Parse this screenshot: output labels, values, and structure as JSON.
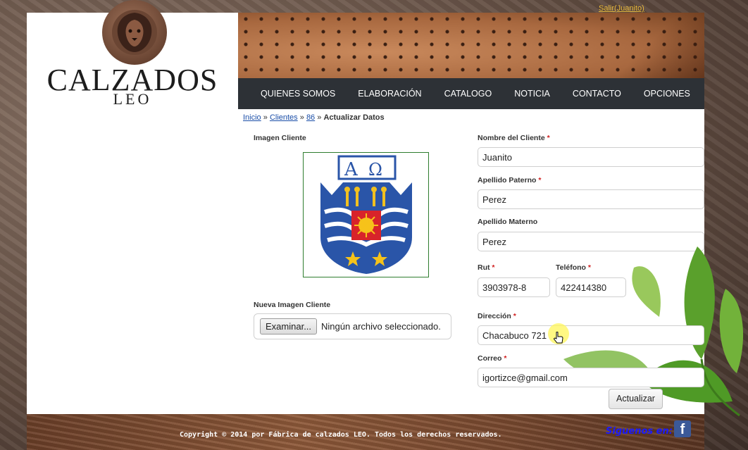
{
  "header": {
    "logout_link": "Salir(Juanito)"
  },
  "logo": {
    "line1": "CALZADOS",
    "line2": "LEO"
  },
  "nav": {
    "items": [
      "QUIENES SOMOS",
      "ELABORACIÓN",
      "CATALOGO",
      "NOTICIA",
      "CONTACTO",
      "OPCIONES"
    ]
  },
  "breadcrumb": {
    "home": "Inicio",
    "sep": "»",
    "clients": "Clientes",
    "id": "86",
    "current": "Actualizar Datos"
  },
  "form": {
    "image_label": "Imagen Cliente",
    "new_image_label": "Nueva Imagen Cliente",
    "file_button": "Examinar...",
    "file_status": "Ningún archivo seleccionado.",
    "required_mark": "*",
    "fields": {
      "nombre": {
        "label": "Nombre del Cliente",
        "value": "Juanito"
      },
      "paterno": {
        "label": "Apellido Paterno",
        "value": "Perez"
      },
      "materno": {
        "label": "Apellido Materno",
        "value": "Perez"
      },
      "rut": {
        "label": "Rut",
        "value": "3903978-8"
      },
      "telefono": {
        "label": "Teléfono",
        "value": "422414380"
      },
      "direccion": {
        "label": "Dirección",
        "value": "Chacabuco 721"
      },
      "correo": {
        "label": "Correo",
        "value": "igortizce@gmail.com"
      }
    },
    "submit": "Actualizar"
  },
  "footer": {
    "copyright": "Copyright © 2014 por Fábrica de calzados LEO. Todos los derechos reservados.",
    "follow": "Siguenos en:",
    "facebook_letter": "f"
  },
  "colors": {
    "nav_bg": "#2d3136",
    "link": "#1a4ea8",
    "logout": "#e8b93b",
    "required": "#d02020",
    "follow": "#1a1aff"
  }
}
